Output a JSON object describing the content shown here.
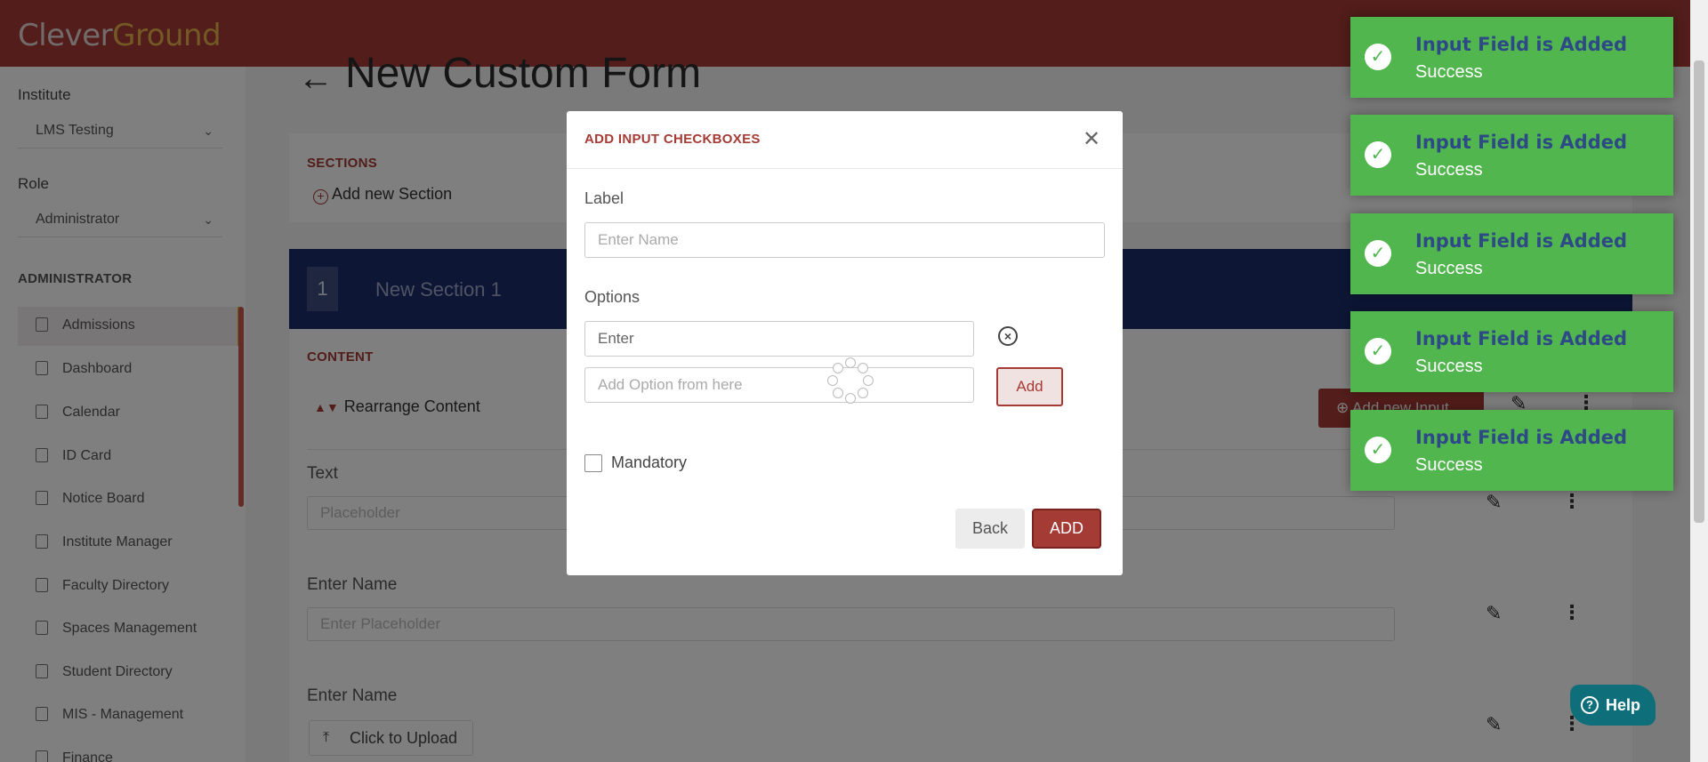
{
  "app": {
    "logo_part1": "Clever",
    "logo_part2": "Ground"
  },
  "sidebar": {
    "institute_label": "Institute",
    "institute_value": "LMS Testing",
    "role_label": "Role",
    "role_value": "Administrator",
    "section_title": "ADMINISTRATOR",
    "items": [
      {
        "label": "Admissions",
        "icon": "document-icon"
      },
      {
        "label": "Dashboard",
        "icon": "chart-icon"
      },
      {
        "label": "Calendar",
        "icon": "calendar-icon"
      },
      {
        "label": "ID Card",
        "icon": "id-card-icon"
      },
      {
        "label": "Notice Board",
        "icon": "megaphone-icon"
      },
      {
        "label": "Institute Manager",
        "icon": "table-icon"
      },
      {
        "label": "Faculty Directory",
        "icon": "person-icon"
      },
      {
        "label": "Spaces Management",
        "icon": "building-icon"
      },
      {
        "label": "Student Directory",
        "icon": "person-icon"
      },
      {
        "label": "MIS - Management",
        "icon": "report-icon"
      },
      {
        "label": "Finance",
        "icon": "money-icon"
      }
    ]
  },
  "page": {
    "title": "New Custom Form",
    "sections_caption": "SECTIONS",
    "add_section": "Add new Section",
    "section_number": "1",
    "section_name": "New Section 1",
    "content_caption": "CONTENT",
    "rearrange": "Rearrange Content",
    "add_input": "Add new Input",
    "fields": [
      {
        "label": "Text",
        "placeholder": "Placeholder"
      },
      {
        "label": "Enter Name",
        "placeholder": "Enter Placeholder"
      },
      {
        "label": "Enter Name",
        "upload_label": "Click to Upload"
      }
    ]
  },
  "modal": {
    "title": "ADD INPUT CHECKBOXES",
    "label_caption": "Label",
    "label_placeholder": "Enter Name",
    "options_caption": "Options",
    "option_value": "Enter",
    "add_option_placeholder": "Add Option from here",
    "add_option_button": "Add",
    "mandatory_label": "Mandatory",
    "back_button": "Back",
    "submit_button": "ADD"
  },
  "toasts": [
    {
      "title": "Input Field is Added",
      "message": "Success"
    },
    {
      "title": "Input Field is Added",
      "message": "Success"
    },
    {
      "title": "Input Field is Added",
      "message": "Success"
    },
    {
      "title": "Input Field is Added",
      "message": "Success"
    },
    {
      "title": "Input Field is Added",
      "message": "Success"
    }
  ],
  "help": {
    "label": "Help"
  },
  "colors": {
    "brand": "#a53b35",
    "accent": "#e6b24a",
    "section_bar": "#1b2d6b",
    "toast": "#52b64f",
    "help": "#0e6e7a"
  }
}
